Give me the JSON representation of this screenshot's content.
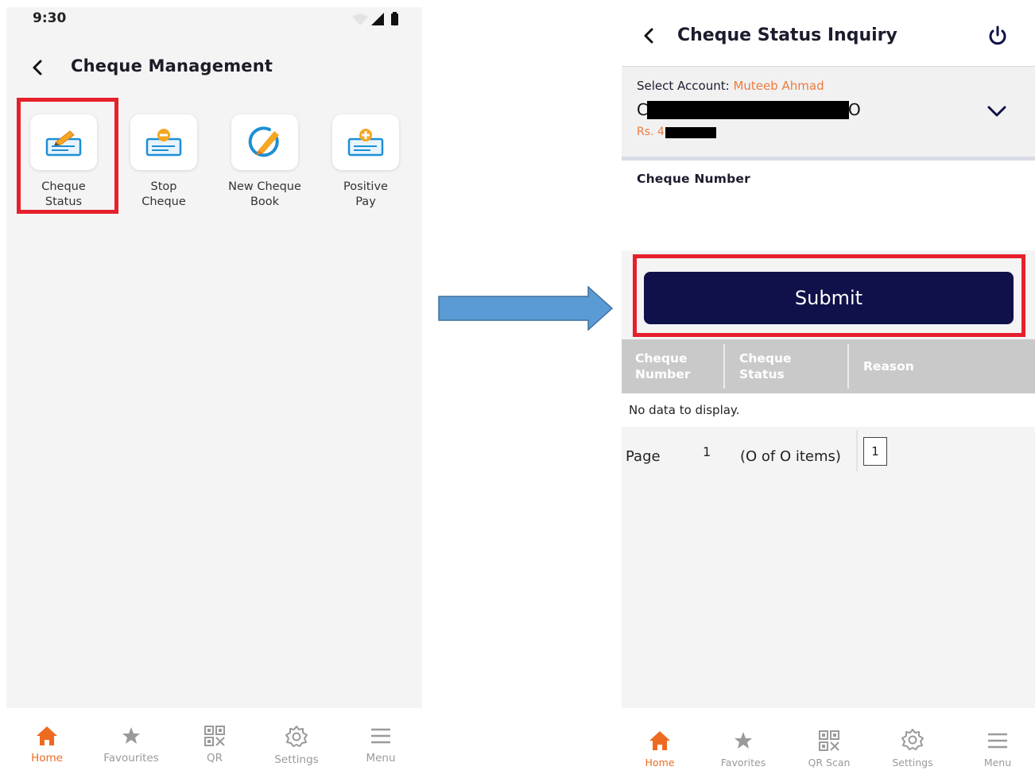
{
  "left_screen": {
    "status_bar": {
      "time": "9:30"
    },
    "header": {
      "title": "Cheque Management"
    },
    "tiles": [
      {
        "label_line1": "Cheque",
        "label_line2": "Status",
        "icon": "cheque-edit-icon"
      },
      {
        "label_line1": "Stop",
        "label_line2": "Cheque",
        "icon": "stop-cheque-icon"
      },
      {
        "label_line1": "New Cheque",
        "label_line2": "Book",
        "icon": "new-cheque-book-icon"
      },
      {
        "label_line1": "Positive",
        "label_line2": "Pay",
        "icon": "positive-pay-icon"
      }
    ],
    "bottom_nav": [
      {
        "label": "Home",
        "icon": "home-icon",
        "active": true
      },
      {
        "label": "Favourites",
        "icon": "star-icon"
      },
      {
        "label": "QR",
        "icon": "qr-code-icon"
      },
      {
        "label": "Settings",
        "icon": "gear-icon"
      },
      {
        "label": "Menu",
        "icon": "hamburger-icon"
      }
    ]
  },
  "right_screen": {
    "header": {
      "title": "Cheque Status Inquiry"
    },
    "account": {
      "label": "Select Account:",
      "name": "Muteeb Ahmad",
      "number_prefix": "C",
      "number_suffix": "O",
      "balance_prefix": "Rs. 4"
    },
    "cheque_field": {
      "label": "Cheque Number",
      "value": ""
    },
    "submit_label": "Submit",
    "grid": {
      "columns": [
        {
          "line1": "Cheque",
          "line2": "Number"
        },
        {
          "line1": "Cheque",
          "line2": "Status"
        },
        {
          "line1": "Reason",
          "line2": ""
        }
      ],
      "empty_text": "No data to display."
    },
    "pager": {
      "label": "Page",
      "current": "1",
      "count_text": "(O of O items)",
      "page_button": "1"
    },
    "bottom_nav": [
      {
        "label": "Home",
        "icon": "home-icon",
        "active": true
      },
      {
        "label": "Favorites",
        "icon": "star-icon"
      },
      {
        "label": "QR Scan",
        "icon": "qr-code-icon"
      },
      {
        "label": "Settings",
        "icon": "gear-icon"
      },
      {
        "label": "Menu",
        "icon": "hamburger-icon"
      }
    ]
  },
  "colors": {
    "accent_orange": "#ee6a21",
    "submit_navy": "#10104a",
    "highlight_red": "#e6202b",
    "arrow_blue": "#5b9bd5"
  }
}
